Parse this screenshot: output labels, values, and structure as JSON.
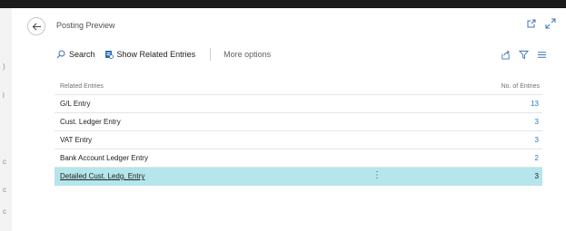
{
  "window": {
    "title": "Posting Preview"
  },
  "toolbar": {
    "search_label": "Search",
    "show_related_label": "Show Related Entries",
    "more_options_label": "More options"
  },
  "table": {
    "headers": {
      "entries": "Related Entries",
      "count": "No. of Entries"
    },
    "rows": [
      {
        "name": "G/L Entry",
        "count": "13"
      },
      {
        "name": "Cust. Ledger Entry",
        "count": "3"
      },
      {
        "name": "VAT Entry",
        "count": "3"
      },
      {
        "name": "Bank Account Ledger Entry",
        "count": "2"
      },
      {
        "name": "Detailed Cust. Ledg. Entry",
        "count": "3",
        "selected": true
      }
    ]
  },
  "colors": {
    "accent": "#1e79c9",
    "selected_row": "#b5e6ec"
  },
  "icons": [
    "back-arrow-icon",
    "open-in-new-window-icon",
    "expand-icon",
    "search-icon",
    "related-entries-icon",
    "share-icon",
    "filter-icon",
    "list-view-icon",
    "row-menu-icon"
  ]
}
